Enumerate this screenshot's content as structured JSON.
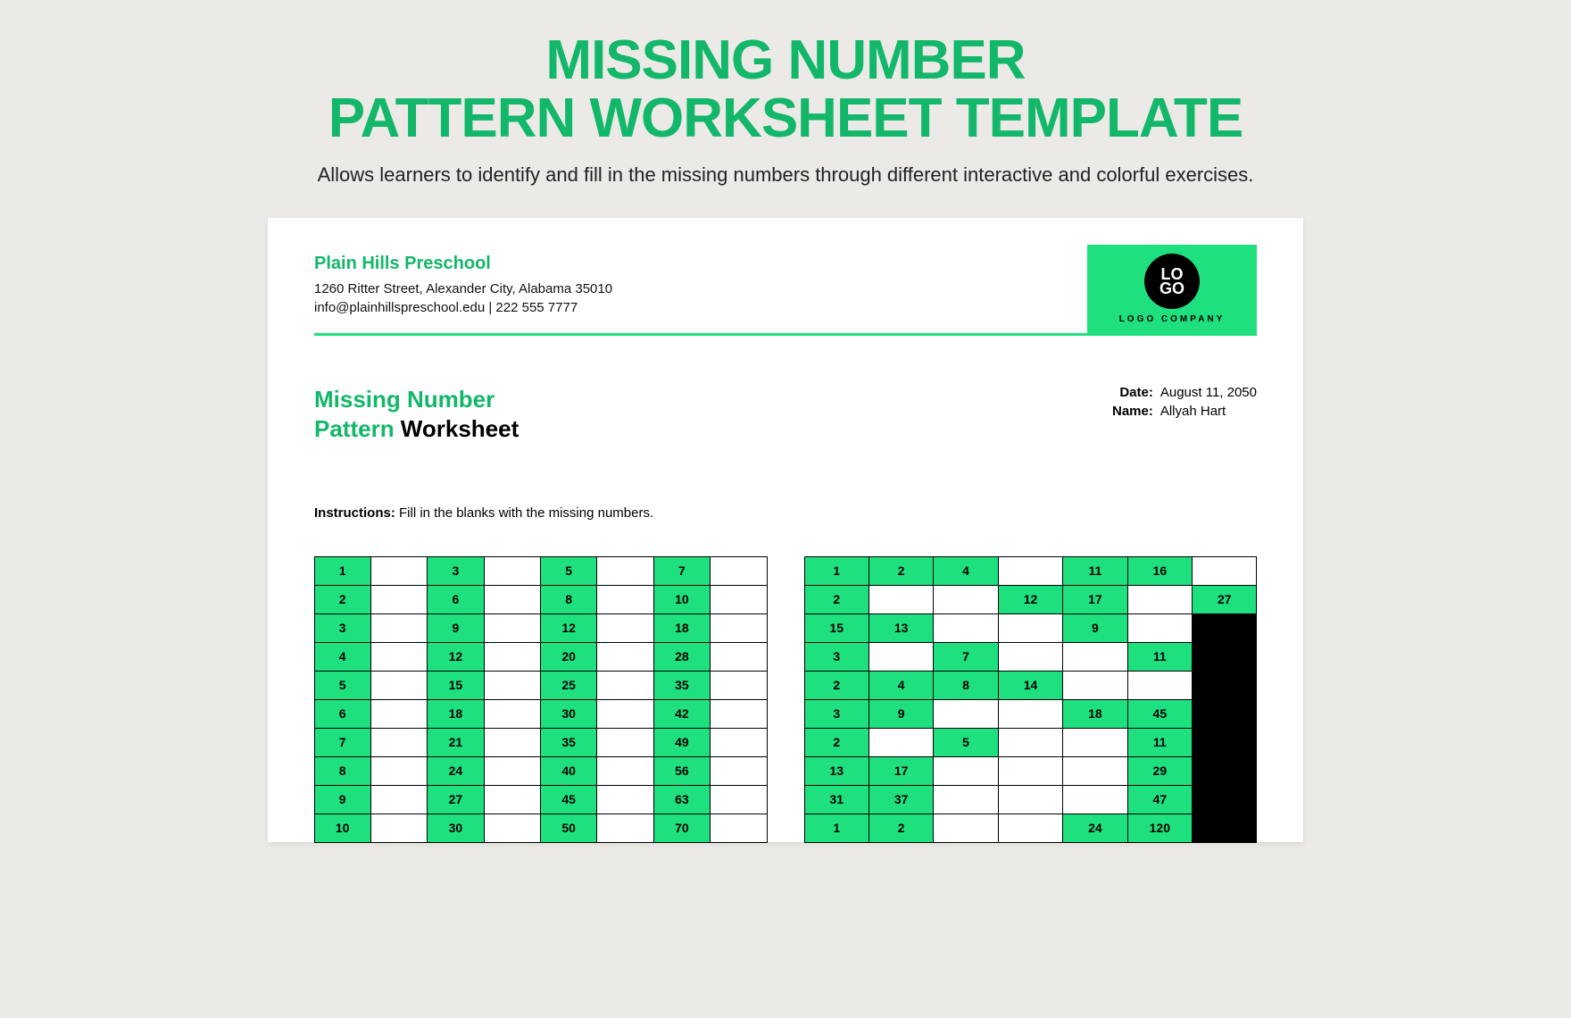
{
  "page": {
    "title_line1": "MISSING NUMBER",
    "title_line2": "PATTERN WORKSHEET TEMPLATE",
    "subtitle": "Allows learners to identify and fill in the missing numbers through different interactive and colorful exercises."
  },
  "org": {
    "name": "Plain Hills Preschool",
    "address": "1260 Ritter Street, Alexander City, Alabama 35010",
    "contact": "info@plainhillspreschool.edu | 222 555 7777"
  },
  "logo": {
    "text": "LO\nGO",
    "caption": "LOGO COMPANY"
  },
  "worksheet": {
    "title_green1": "Missing Number",
    "title_green2": "Pattern",
    "title_black": " Worksheet",
    "date_label": "Date:",
    "date_value": "August 11, 2050",
    "name_label": "Name:",
    "name_value": "Allyah Hart",
    "instructions_label": "Instructions:",
    "instructions_text": "  Fill in the blanks with the missing numbers."
  },
  "grid1": [
    [
      {
        "v": "1",
        "t": "f"
      },
      {
        "v": "",
        "t": "b"
      },
      {
        "v": "3",
        "t": "f"
      },
      {
        "v": "",
        "t": "b"
      },
      {
        "v": "5",
        "t": "f"
      },
      {
        "v": "",
        "t": "b"
      },
      {
        "v": "7",
        "t": "f"
      },
      {
        "v": "",
        "t": "b"
      }
    ],
    [
      {
        "v": "2",
        "t": "f"
      },
      {
        "v": "",
        "t": "b"
      },
      {
        "v": "6",
        "t": "f"
      },
      {
        "v": "",
        "t": "b"
      },
      {
        "v": "8",
        "t": "f"
      },
      {
        "v": "",
        "t": "b"
      },
      {
        "v": "10",
        "t": "f"
      },
      {
        "v": "",
        "t": "b"
      }
    ],
    [
      {
        "v": "3",
        "t": "f"
      },
      {
        "v": "",
        "t": "b"
      },
      {
        "v": "9",
        "t": "f"
      },
      {
        "v": "",
        "t": "b"
      },
      {
        "v": "12",
        "t": "f"
      },
      {
        "v": "",
        "t": "b"
      },
      {
        "v": "18",
        "t": "f"
      },
      {
        "v": "",
        "t": "b"
      }
    ],
    [
      {
        "v": "4",
        "t": "f"
      },
      {
        "v": "",
        "t": "b"
      },
      {
        "v": "12",
        "t": "f"
      },
      {
        "v": "",
        "t": "b"
      },
      {
        "v": "20",
        "t": "f"
      },
      {
        "v": "",
        "t": "b"
      },
      {
        "v": "28",
        "t": "f"
      },
      {
        "v": "",
        "t": "b"
      }
    ],
    [
      {
        "v": "5",
        "t": "f"
      },
      {
        "v": "",
        "t": "b"
      },
      {
        "v": "15",
        "t": "f"
      },
      {
        "v": "",
        "t": "b"
      },
      {
        "v": "25",
        "t": "f"
      },
      {
        "v": "",
        "t": "b"
      },
      {
        "v": "35",
        "t": "f"
      },
      {
        "v": "",
        "t": "b"
      }
    ],
    [
      {
        "v": "6",
        "t": "f"
      },
      {
        "v": "",
        "t": "b"
      },
      {
        "v": "18",
        "t": "f"
      },
      {
        "v": "",
        "t": "b"
      },
      {
        "v": "30",
        "t": "f"
      },
      {
        "v": "",
        "t": "b"
      },
      {
        "v": "42",
        "t": "f"
      },
      {
        "v": "",
        "t": "b"
      }
    ],
    [
      {
        "v": "7",
        "t": "f"
      },
      {
        "v": "",
        "t": "b"
      },
      {
        "v": "21",
        "t": "f"
      },
      {
        "v": "",
        "t": "b"
      },
      {
        "v": "35",
        "t": "f"
      },
      {
        "v": "",
        "t": "b"
      },
      {
        "v": "49",
        "t": "f"
      },
      {
        "v": "",
        "t": "b"
      }
    ],
    [
      {
        "v": "8",
        "t": "f"
      },
      {
        "v": "",
        "t": "b"
      },
      {
        "v": "24",
        "t": "f"
      },
      {
        "v": "",
        "t": "b"
      },
      {
        "v": "40",
        "t": "f"
      },
      {
        "v": "",
        "t": "b"
      },
      {
        "v": "56",
        "t": "f"
      },
      {
        "v": "",
        "t": "b"
      }
    ],
    [
      {
        "v": "9",
        "t": "f"
      },
      {
        "v": "",
        "t": "b"
      },
      {
        "v": "27",
        "t": "f"
      },
      {
        "v": "",
        "t": "b"
      },
      {
        "v": "45",
        "t": "f"
      },
      {
        "v": "",
        "t": "b"
      },
      {
        "v": "63",
        "t": "f"
      },
      {
        "v": "",
        "t": "b"
      }
    ],
    [
      {
        "v": "10",
        "t": "f"
      },
      {
        "v": "",
        "t": "b"
      },
      {
        "v": "30",
        "t": "f"
      },
      {
        "v": "",
        "t": "b"
      },
      {
        "v": "50",
        "t": "f"
      },
      {
        "v": "",
        "t": "b"
      },
      {
        "v": "70",
        "t": "f"
      },
      {
        "v": "",
        "t": "b"
      }
    ]
  ],
  "grid2": [
    [
      {
        "v": "1",
        "t": "f"
      },
      {
        "v": "2",
        "t": "f"
      },
      {
        "v": "4",
        "t": "f"
      },
      {
        "v": "",
        "t": "b"
      },
      {
        "v": "11",
        "t": "f"
      },
      {
        "v": "16",
        "t": "f"
      },
      {
        "v": "",
        "t": "b"
      }
    ],
    [
      {
        "v": "2",
        "t": "f"
      },
      {
        "v": "",
        "t": "b"
      },
      {
        "v": "",
        "t": "b"
      },
      {
        "v": "12",
        "t": "f"
      },
      {
        "v": "17",
        "t": "f"
      },
      {
        "v": "",
        "t": "b"
      },
      {
        "v": "27",
        "t": "f"
      }
    ],
    [
      {
        "v": "15",
        "t": "f"
      },
      {
        "v": "13",
        "t": "f"
      },
      {
        "v": "",
        "t": "b"
      },
      {
        "v": "",
        "t": "b"
      },
      {
        "v": "9",
        "t": "f"
      },
      {
        "v": "",
        "t": "b"
      },
      {
        "v": "",
        "t": "d"
      }
    ],
    [
      {
        "v": "3",
        "t": "f"
      },
      {
        "v": "",
        "t": "b"
      },
      {
        "v": "7",
        "t": "f"
      },
      {
        "v": "",
        "t": "b"
      },
      {
        "v": "",
        "t": "b"
      },
      {
        "v": "11",
        "t": "f"
      },
      {
        "v": "",
        "t": "d"
      }
    ],
    [
      {
        "v": "2",
        "t": "f"
      },
      {
        "v": "4",
        "t": "f"
      },
      {
        "v": "8",
        "t": "f"
      },
      {
        "v": "14",
        "t": "f"
      },
      {
        "v": "",
        "t": "b"
      },
      {
        "v": "",
        "t": "b"
      },
      {
        "v": "",
        "t": "d"
      }
    ],
    [
      {
        "v": "3",
        "t": "f"
      },
      {
        "v": "9",
        "t": "f"
      },
      {
        "v": "",
        "t": "b"
      },
      {
        "v": "",
        "t": "b"
      },
      {
        "v": "18",
        "t": "f"
      },
      {
        "v": "45",
        "t": "f"
      },
      {
        "v": "",
        "t": "d"
      }
    ],
    [
      {
        "v": "2",
        "t": "f"
      },
      {
        "v": "",
        "t": "b"
      },
      {
        "v": "5",
        "t": "f"
      },
      {
        "v": "",
        "t": "b"
      },
      {
        "v": "",
        "t": "b"
      },
      {
        "v": "11",
        "t": "f"
      },
      {
        "v": "",
        "t": "d"
      }
    ],
    [
      {
        "v": "13",
        "t": "f"
      },
      {
        "v": "17",
        "t": "f"
      },
      {
        "v": "",
        "t": "b"
      },
      {
        "v": "",
        "t": "b"
      },
      {
        "v": "",
        "t": "b"
      },
      {
        "v": "29",
        "t": "f"
      },
      {
        "v": "",
        "t": "d"
      }
    ],
    [
      {
        "v": "31",
        "t": "f"
      },
      {
        "v": "37",
        "t": "f"
      },
      {
        "v": "",
        "t": "b"
      },
      {
        "v": "",
        "t": "b"
      },
      {
        "v": "",
        "t": "b"
      },
      {
        "v": "47",
        "t": "f"
      },
      {
        "v": "",
        "t": "d"
      }
    ],
    [
      {
        "v": "1",
        "t": "f"
      },
      {
        "v": "2",
        "t": "f"
      },
      {
        "v": "",
        "t": "b"
      },
      {
        "v": "",
        "t": "b"
      },
      {
        "v": "24",
        "t": "f"
      },
      {
        "v": "120",
        "t": "f"
      },
      {
        "v": "",
        "t": "d"
      }
    ]
  ]
}
